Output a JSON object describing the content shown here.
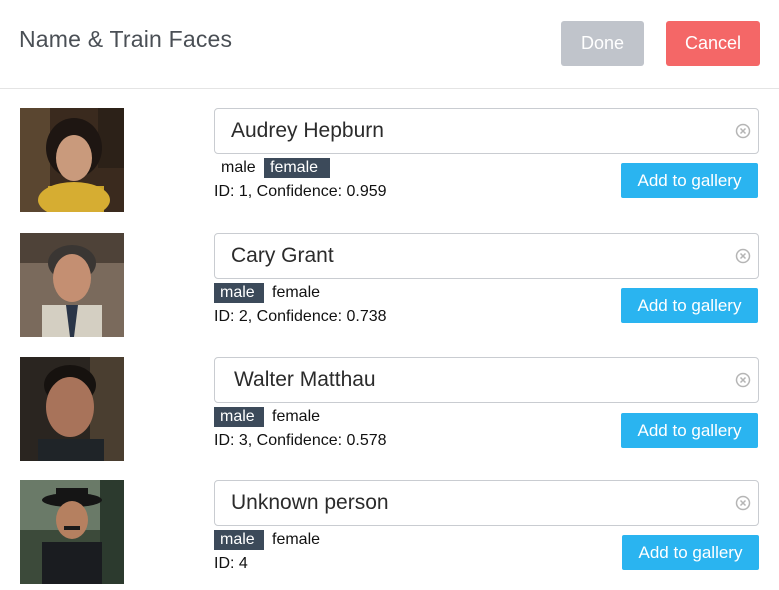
{
  "header": {
    "title": "Name & Train Faces",
    "done_label": "Done",
    "cancel_label": "Cancel"
  },
  "faces": [
    {
      "name": "Audrey Hepburn",
      "gender_male": "male",
      "gender_female": "female",
      "selected_gender": "female",
      "meta": "ID: 1, Confidence: 0.959",
      "add_label": "Add to gallery"
    },
    {
      "name": "Cary Grant",
      "gender_male": "male",
      "gender_female": "female",
      "selected_gender": "male",
      "meta": "ID: 2, Confidence: 0.738",
      "add_label": "Add to gallery"
    },
    {
      "name": "Walter Matthau",
      "gender_male": "male",
      "gender_female": "female",
      "selected_gender": "male",
      "meta": "ID: 3, Confidence: 0.578",
      "add_label": "Add to gallery"
    },
    {
      "name": "Unknown person",
      "gender_male": "male",
      "gender_female": "female",
      "selected_gender": "male",
      "meta": "ID: 4",
      "add_label": "Add to gallery"
    }
  ],
  "colors": {
    "done_bg": "#c0c4cb",
    "cancel_bg": "#f46767",
    "add_bg": "#2ab4f0",
    "selected_tag_bg": "#3c4a5a"
  },
  "icons": {
    "clear": "clear-circle-icon"
  }
}
